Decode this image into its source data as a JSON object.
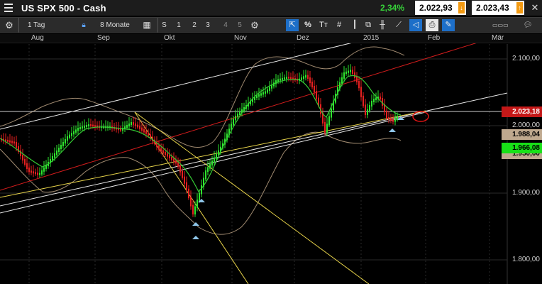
{
  "window": {
    "title": "US SPX 500 - Cash",
    "change": "2,34%",
    "sell_price": "2.022,93",
    "buy_price": "2.023,43",
    "close_label": "✕"
  },
  "toolbar": {
    "interval": "1 Tag",
    "period": "8 Monate",
    "s_label": "S",
    "one_label": "1",
    "two_label": "2",
    "three_label": "3",
    "four_label": "4",
    "five_label": "5",
    "percent_label": "%",
    "text_label": "Tт"
  },
  "axis": {
    "months": [
      "Aug",
      "Sep",
      "Okt",
      "Nov",
      "Dez",
      "2015",
      "Feb",
      "Mär"
    ],
    "prices": [
      "2.100,00",
      "2.000,00",
      "1.900,00",
      "1.800,00"
    ]
  },
  "price_tags": {
    "current": "2.023,18",
    "level_a": "1.988,04",
    "level_b": "1.966,08",
    "level_c": "1.950,00"
  },
  "colors": {
    "background": "#000000",
    "up_candle": "#2ee62e",
    "down_candle": "#e62020",
    "channel_white": "#e8e8e8",
    "trend_red": "#d21c1c",
    "trend_yellow": "#e8d44a",
    "bollinger": "#a08a70",
    "moving_average": "#34c934",
    "accent_blue": "#1d6fc9",
    "change_green": "#37d43a",
    "arrow_orange": "#f39a11"
  }
}
